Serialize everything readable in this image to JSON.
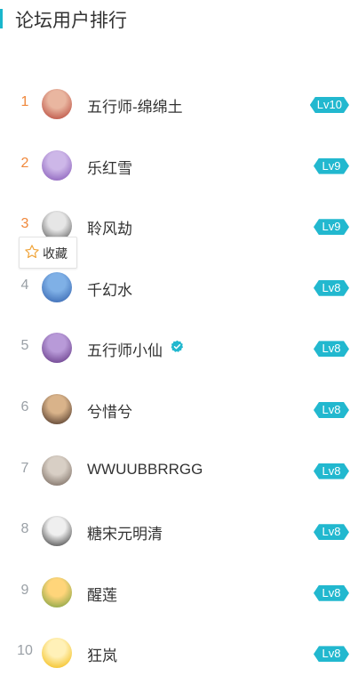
{
  "header": {
    "title": "论坛用户排行"
  },
  "favorite": {
    "label": "收藏"
  },
  "users": [
    {
      "rank": "1",
      "name": "五行师-绵绵土",
      "level": "Lv10",
      "avatar_colors": [
        "#e9b6a0",
        "#b23a2e"
      ]
    },
    {
      "rank": "2",
      "name": "乐红雪",
      "level": "Lv9",
      "avatar_colors": [
        "#cdb7e8",
        "#7e4fb3"
      ]
    },
    {
      "rank": "3",
      "name": "聆风劫",
      "level": "Lv9",
      "avatar_colors": [
        "#e6e6e6",
        "#4b4b4b"
      ]
    },
    {
      "rank": "4",
      "name": "千幻水",
      "level": "Lv8",
      "avatar_colors": [
        "#7fb0e6",
        "#2b5aa8"
      ]
    },
    {
      "rank": "5",
      "name": "五行师小仙",
      "level": "Lv8",
      "verified": true,
      "avatar_colors": [
        "#b89ad8",
        "#5a2c7c"
      ]
    },
    {
      "rank": "6",
      "name": "兮惜兮",
      "level": "Lv8",
      "avatar_colors": [
        "#d9b38a",
        "#3a241a"
      ]
    },
    {
      "rank": "7",
      "name": "WWUUBBRRGG",
      "level": "Lv8",
      "avatar_colors": [
        "#d8cfc5",
        "#6b5c52"
      ]
    },
    {
      "rank": "8",
      "name": "糖宋元明清",
      "level": "Lv8",
      "avatar_colors": [
        "#efefef",
        "#2a2a2a"
      ]
    },
    {
      "rank": "9",
      "name": "醒莲",
      "level": "Lv8",
      "avatar_colors": [
        "#ffd57a",
        "#6d9a3a"
      ]
    },
    {
      "rank": "10",
      "name": "狂岚",
      "level": "Lv8",
      "avatar_colors": [
        "#fff1b8",
        "#f1b500"
      ]
    }
  ],
  "colors": {
    "accent": "#19b6cc",
    "level_badge": "#22b8cf",
    "top_rank": "#f0883b",
    "rank": "#9aa0a6"
  }
}
